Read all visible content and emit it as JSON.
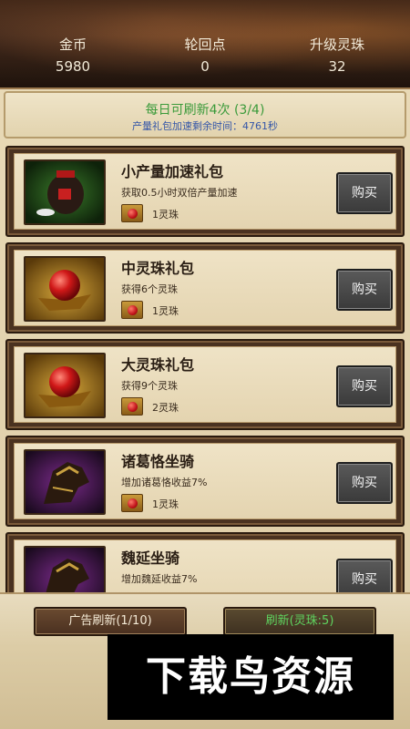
{
  "header": {
    "stats": [
      {
        "label": "金币",
        "value": "5980"
      },
      {
        "label": "轮回点",
        "value": "0"
      },
      {
        "label": "升级灵珠",
        "value": "32"
      }
    ]
  },
  "refresh_info": {
    "title": "每日可刷新4次 (3/4)",
    "subtitle": "产量礼包加速剩余时间：4761秒"
  },
  "items": [
    {
      "name": "小产量加速礼包",
      "desc": "获取0.5小时双倍产量加速",
      "cost": "1灵珠",
      "buy_label": "购买",
      "icon": "wine-jar-icon"
    },
    {
      "name": "中灵珠礼包",
      "desc": "获得6个灵珠",
      "cost": "1灵珠",
      "buy_label": "购买",
      "icon": "red-pearl-icon"
    },
    {
      "name": "大灵珠礼包",
      "desc": "获得9个灵珠",
      "cost": "2灵珠",
      "buy_label": "购买",
      "icon": "red-pearl-icon"
    },
    {
      "name": "诸葛恪坐骑",
      "desc": "增加诸葛恪收益7%",
      "cost": "1灵珠",
      "buy_label": "购买",
      "icon": "mount-horse-icon"
    },
    {
      "name": "魏延坐骑",
      "desc": "增加魏延收益7%",
      "cost": "",
      "buy_label": "购买",
      "icon": "mount-horse-icon"
    }
  ],
  "bottom": {
    "ad_refresh": "广告刷新(1/10)",
    "pearl_refresh": "刷新(灵珠:5)"
  },
  "watermark": "下载鸟资源",
  "colors": {
    "accent_green": "#3a9a3a",
    "accent_blue": "#3456a8",
    "parchment": "#e8d9b6",
    "frame_brown": "#4a3220"
  }
}
